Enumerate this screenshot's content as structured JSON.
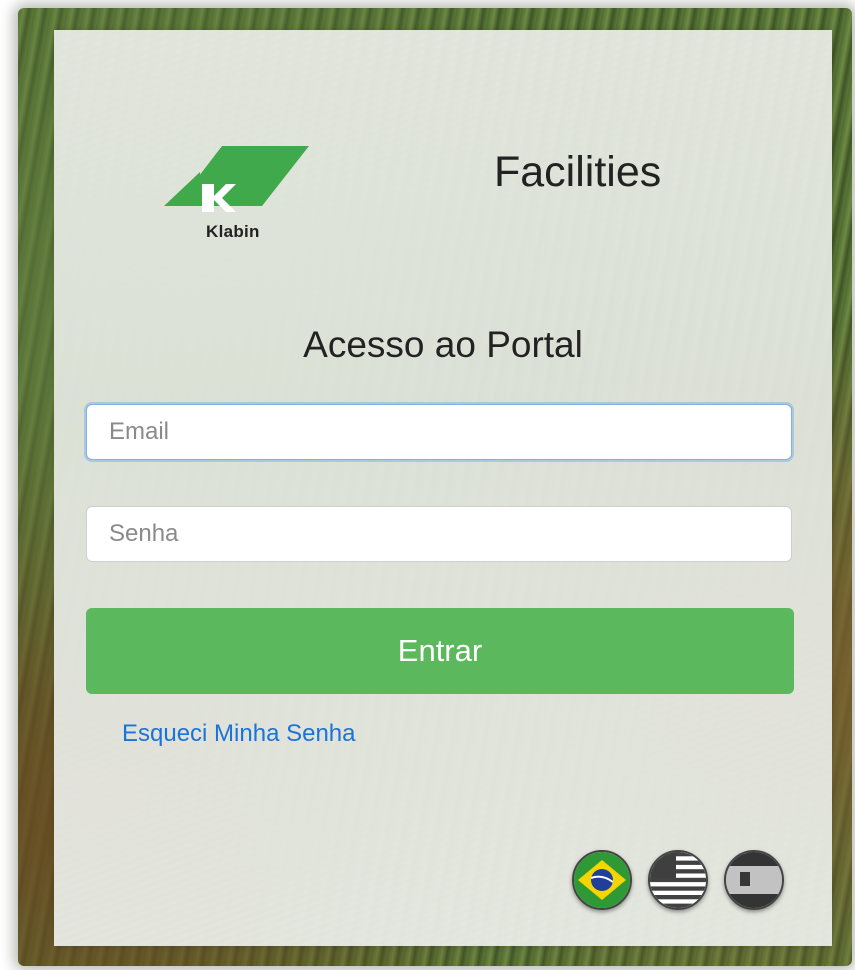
{
  "brand": {
    "name": "Klabin",
    "accent_color": "#3fa94b"
  },
  "app_title": "Facilities",
  "portal_title": "Acesso ao Portal",
  "form": {
    "email_placeholder": "Email",
    "email_value": "",
    "password_placeholder": "Senha",
    "password_value": "",
    "submit_label": "Entrar",
    "submit_color": "#5cb85c",
    "forgot_password_label": "Esqueci Minha Senha",
    "link_color": "#1a73d9"
  },
  "languages": [
    {
      "icon": "brazil-flag-icon",
      "active": true
    },
    {
      "icon": "usa-flag-icon",
      "active": false
    },
    {
      "icon": "spain-flag-icon",
      "active": false
    }
  ]
}
